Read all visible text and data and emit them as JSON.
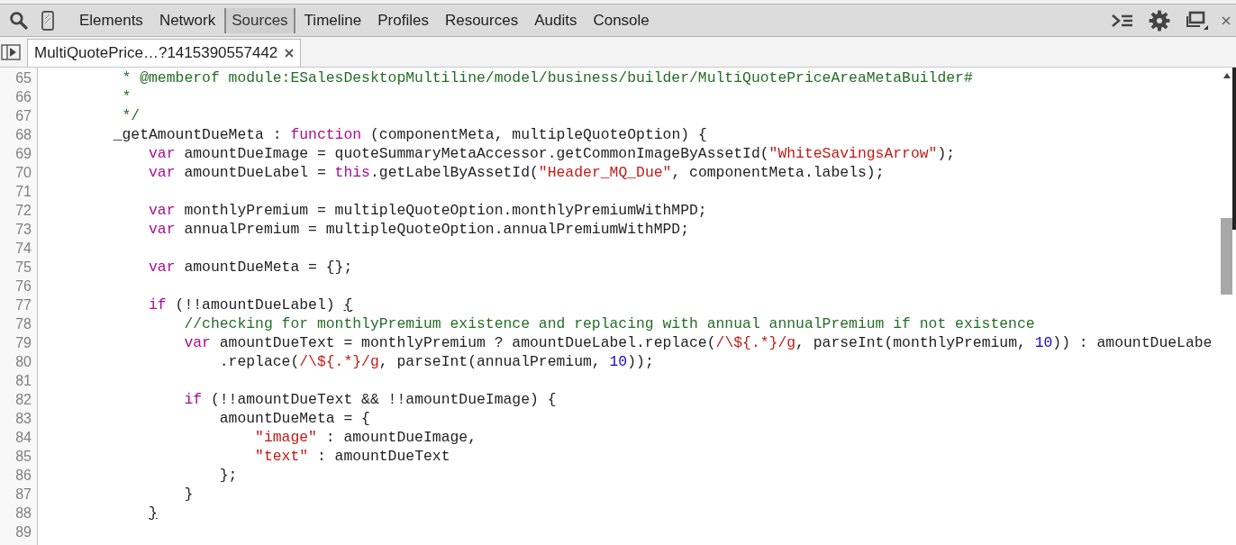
{
  "toolbar": {
    "tabs": [
      {
        "label": "Elements",
        "selected": false
      },
      {
        "label": "Network",
        "selected": false
      },
      {
        "label": "Sources",
        "selected": true
      },
      {
        "label": "Timeline",
        "selected": false
      },
      {
        "label": "Profiles",
        "selected": false
      },
      {
        "label": "Resources",
        "selected": false
      },
      {
        "label": "Audits",
        "selected": false
      },
      {
        "label": "Console",
        "selected": false
      }
    ]
  },
  "file_tabs": [
    {
      "label": "MultiQuotePrice…?1415390557442",
      "selected": true
    }
  ],
  "editor": {
    "lines": [
      {
        "number": "65",
        "tokens": [
          {
            "kind": "comment",
            "text": "         * @memberof module:ESalesDesktopMultiline/model/business/builder/MultiQuotePriceAreaMetaBuilder#"
          }
        ]
      },
      {
        "number": "66",
        "tokens": [
          {
            "kind": "comment",
            "text": "         *"
          }
        ]
      },
      {
        "number": "67",
        "tokens": [
          {
            "kind": "comment",
            "text": "         */"
          }
        ]
      },
      {
        "number": "68",
        "tokens": [
          {
            "kind": "plain",
            "text": "        _getAmountDueMeta : "
          },
          {
            "kind": "keyword",
            "text": "function"
          },
          {
            "kind": "plain",
            "text": " (componentMeta, multipleQuoteOption) {"
          }
        ]
      },
      {
        "number": "69",
        "tokens": [
          {
            "kind": "keyword",
            "text": "            var"
          },
          {
            "kind": "plain",
            "text": " amountDueImage = quoteSummaryMetaAccessor.getCommonImageByAssetId("
          },
          {
            "kind": "string",
            "text": "\"WhiteSavingsArrow\""
          },
          {
            "kind": "plain",
            "text": ");"
          }
        ]
      },
      {
        "number": "70",
        "tokens": [
          {
            "kind": "keyword",
            "text": "            var"
          },
          {
            "kind": "plain",
            "text": " amountDueLabel = "
          },
          {
            "kind": "keyword",
            "text": "this"
          },
          {
            "kind": "plain",
            "text": ".getLabelByAssetId("
          },
          {
            "kind": "string",
            "text": "\"Header_MQ_Due\""
          },
          {
            "kind": "plain",
            "text": ", componentMeta.labels);"
          }
        ]
      },
      {
        "number": "71"
      },
      {
        "number": "72",
        "tokens": [
          {
            "kind": "keyword",
            "text": "            var"
          },
          {
            "kind": "plain",
            "text": " monthlyPremium = multipleQuoteOption.monthlyPremiumWithMPD;"
          }
        ]
      },
      {
        "number": "73",
        "tokens": [
          {
            "kind": "keyword",
            "text": "            var"
          },
          {
            "kind": "plain",
            "text": " annualPremium = multipleQuoteOption.annualPremiumWithMPD;"
          }
        ]
      },
      {
        "number": "74"
      },
      {
        "number": "75",
        "tokens": [
          {
            "kind": "keyword",
            "text": "            var"
          },
          {
            "kind": "plain",
            "text": " amountDueMeta = {};"
          }
        ]
      },
      {
        "number": "76"
      },
      {
        "number": "77",
        "tokens": [
          {
            "kind": "keyword",
            "text": "            if"
          },
          {
            "kind": "plain",
            "text": " (!!amountDueLabel) "
          },
          {
            "kind": "matched-bracket",
            "text": "{"
          }
        ]
      },
      {
        "number": "78",
        "tokens": [
          {
            "kind": "comment",
            "text": "                //checking for monthlyPremium existence and replacing with annual annualPremium if not existence"
          }
        ]
      },
      {
        "number": "79",
        "tokens": [
          {
            "kind": "keyword",
            "text": "                var"
          },
          {
            "kind": "plain",
            "text": " amountDueText = monthlyPremium ? amountDueLabel.replace("
          },
          {
            "kind": "regex",
            "text": "/\\${.*}/g"
          },
          {
            "kind": "plain",
            "text": ", parseInt(monthlyPremium, "
          },
          {
            "kind": "number",
            "text": "10"
          },
          {
            "kind": "plain",
            "text": ")) : amountDueLabe"
          }
        ]
      },
      {
        "number": "80",
        "tokens": [
          {
            "kind": "plain",
            "text": "                    .replace("
          },
          {
            "kind": "regex",
            "text": "/\\${.*}/g"
          },
          {
            "kind": "plain",
            "text": ", parseInt(annualPremium, "
          },
          {
            "kind": "number",
            "text": "10"
          },
          {
            "kind": "plain",
            "text": "));"
          }
        ]
      },
      {
        "number": "81"
      },
      {
        "number": "82",
        "tokens": [
          {
            "kind": "keyword",
            "text": "                if"
          },
          {
            "kind": "plain",
            "text": " (!!amountDueText && !!amountDueImage) {"
          }
        ]
      },
      {
        "number": "83",
        "tokens": [
          {
            "kind": "plain",
            "text": "                    amountDueMeta = {"
          }
        ]
      },
      {
        "number": "84",
        "tokens": [
          {
            "kind": "string",
            "text": "                        \"image\""
          },
          {
            "kind": "plain",
            "text": " : amountDueImage,"
          }
        ]
      },
      {
        "number": "85",
        "tokens": [
          {
            "kind": "string",
            "text": "                        \"text\""
          },
          {
            "kind": "plain",
            "text": " : amountDueText"
          }
        ]
      },
      {
        "number": "86",
        "tokens": [
          {
            "kind": "plain",
            "text": "                    };"
          }
        ]
      },
      {
        "number": "87",
        "tokens": [
          {
            "kind": "plain",
            "text": "                }"
          }
        ]
      },
      {
        "number": "88",
        "tokens": [
          {
            "kind": "matched-bracket",
            "text": "            }"
          }
        ]
      },
      {
        "number": "89"
      }
    ]
  }
}
